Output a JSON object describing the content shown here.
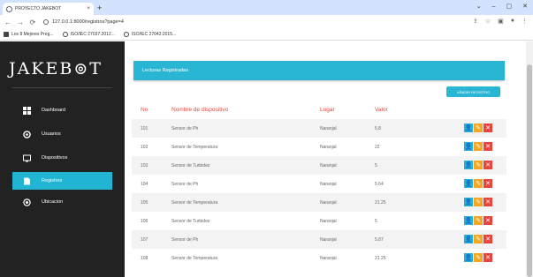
{
  "browser": {
    "tab_title": "PROYECTO JAKEBOT",
    "tab_close": "×",
    "new_tab": "+",
    "url": "127.0.0.1:8000/registros?page=4",
    "window_controls": [
      "⌄",
      "–",
      "▢",
      "✕"
    ],
    "bookmarks": [
      "Los 8 Mejores Prog...",
      "ISO/IEC 27037:2012...",
      "ISO/IEC 27042:2015..."
    ]
  },
  "sidebar": {
    "logo": "JAKEB⊚T",
    "items": [
      {
        "label": "Dashboard",
        "icon": "dashboard-icon"
      },
      {
        "label": "Usuarios",
        "icon": "user-icon"
      },
      {
        "label": "Dispositivos",
        "icon": "device-icon"
      },
      {
        "label": "Registros",
        "icon": "document-icon",
        "active": true
      },
      {
        "label": "Ubicacion",
        "icon": "location-icon"
      }
    ]
  },
  "main": {
    "header_title": "Lecturas Registradas",
    "add_button": "AÑADIR REGISTRO",
    "columns": [
      "No",
      "Nombre de dispositivo",
      "Lugar",
      "Valor"
    ],
    "rows": [
      {
        "no": "101",
        "device": "Sensor de Ph",
        "place": "Naranjal",
        "value": "5.8"
      },
      {
        "no": "102",
        "device": "Sensor de Temperatura",
        "place": "Naranjal",
        "value": "22"
      },
      {
        "no": "103",
        "device": "Sensor de Turbidez",
        "place": "Naranjal",
        "value": "5"
      },
      {
        "no": "104",
        "device": "Sensor de Ph",
        "place": "Naranjal",
        "value": "5.64"
      },
      {
        "no": "105",
        "device": "Sensor de Temperatura",
        "place": "Naranjal",
        "value": "21.25"
      },
      {
        "no": "106",
        "device": "Sensor de Turbidez",
        "place": "Naranjal",
        "value": "5"
      },
      {
        "no": "107",
        "device": "Sensor de Ph",
        "place": "Naranjal",
        "value": "5.87"
      },
      {
        "no": "108",
        "device": "Sensor de Temperatura",
        "place": "Naranjal",
        "value": "21.25"
      }
    ],
    "actions": {
      "view": "👤",
      "edit": "✎",
      "delete": "✕"
    }
  },
  "colors": {
    "accent": "#29b6d4",
    "edit": "#f5a623",
    "delete": "#e8453c",
    "sidebar": "#222222",
    "header_text": "#e8453c"
  }
}
